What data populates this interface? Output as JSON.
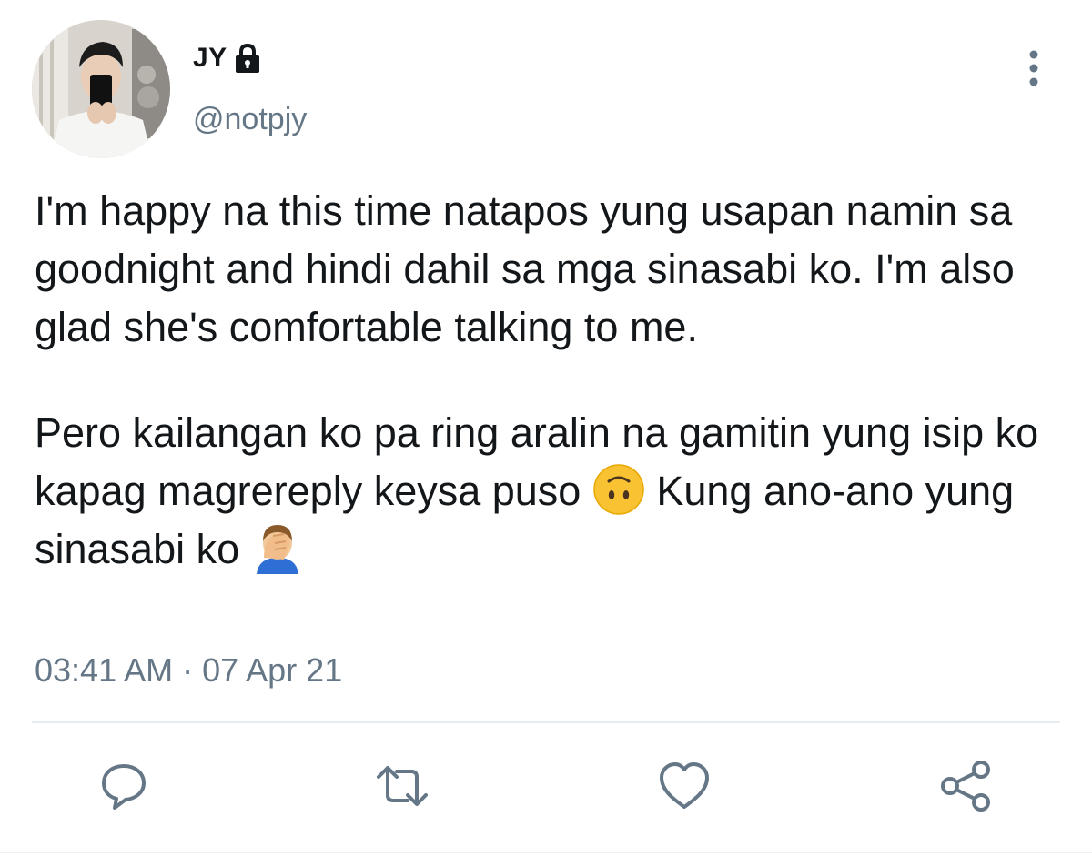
{
  "author": {
    "display_name": "JY",
    "handle": "@notpjy",
    "protected_icon": "lock-icon",
    "avatar": "profile-photo"
  },
  "tweet": {
    "paragraph_1": "I'm happy na this time natapos yung usapan namin sa goodnight and hindi dahil sa mga sinasabi ko. I'm also glad she's comfortable talking to me.",
    "paragraph_2_part_1": "Pero kailangan ko pa ring aralin na gamitin yung isip ko kapag magrereply keysa puso ",
    "paragraph_2_emoji_1": "upside-down-face-emoji",
    "paragraph_2_part_2": " Kung ano-ano yung sinasabi ko ",
    "paragraph_2_emoji_2": "man-facepalming-emoji",
    "timestamp": "03:41 AM · 07 Apr 21"
  },
  "actions": {
    "reply_icon": "reply-icon",
    "retweet_icon": "retweet-icon",
    "like_icon": "heart-icon",
    "share_icon": "share-icon",
    "more_icon": "more-vertical-icon"
  },
  "colors": {
    "text_primary": "#14171a",
    "text_secondary": "#657786",
    "divider": "#e6ecf0",
    "icon": "#657786"
  }
}
